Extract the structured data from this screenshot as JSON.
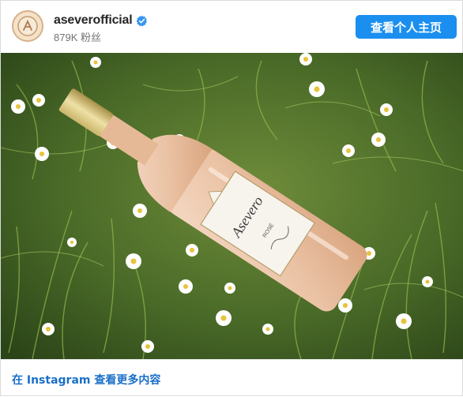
{
  "profile": {
    "username": "aseverofficial",
    "followers": "879K 粉丝",
    "profile_button": "查看个人主页"
  },
  "post": {
    "label_brand": "Asevero",
    "label_type": "ROSÉ"
  },
  "footer": {
    "more_link": "在 Instagram 查看更多内容"
  },
  "colors": {
    "button_blue": "#1a8ff0",
    "link_blue": "#1a6fc9",
    "verified_blue": "#3797f0"
  },
  "icons": {
    "verified": "verified-badge-icon",
    "avatar": "brand-logo-icon"
  }
}
